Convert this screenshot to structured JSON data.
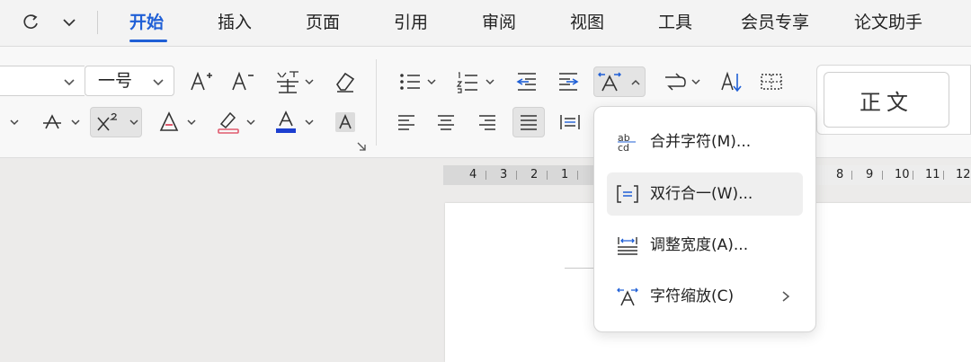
{
  "menu": {
    "tabs": [
      {
        "label": "开始",
        "active": true
      },
      {
        "label": "插入"
      },
      {
        "label": "页面"
      },
      {
        "label": "引用"
      },
      {
        "label": "审阅"
      },
      {
        "label": "视图"
      },
      {
        "label": "工具"
      },
      {
        "label": "会员专享"
      },
      {
        "label": "论文助手"
      }
    ]
  },
  "ribbon": {
    "font_size": "一号",
    "styles": {
      "normal": "正文"
    }
  },
  "ruler": {
    "left_numbers": [
      "4",
      "3",
      "2",
      "1"
    ],
    "right_numbers": [
      "8",
      "9",
      "10",
      "11",
      "12"
    ]
  },
  "popup_menu": {
    "items": [
      {
        "label": "合并字符(M)...",
        "icon": "combine-characters-icon"
      },
      {
        "label": "双行合一(W)...",
        "icon": "double-line-combine-icon",
        "hovered": true
      },
      {
        "label": "调整宽度(A)...",
        "icon": "adjust-width-icon"
      },
      {
        "label": "字符缩放(C)",
        "icon": "character-scale-icon",
        "has_submenu": true
      }
    ]
  },
  "colors": {
    "accent": "#1f5fd6",
    "font_color_bar": "#1d3fd0",
    "eraser_pink": "#e05a6e"
  }
}
